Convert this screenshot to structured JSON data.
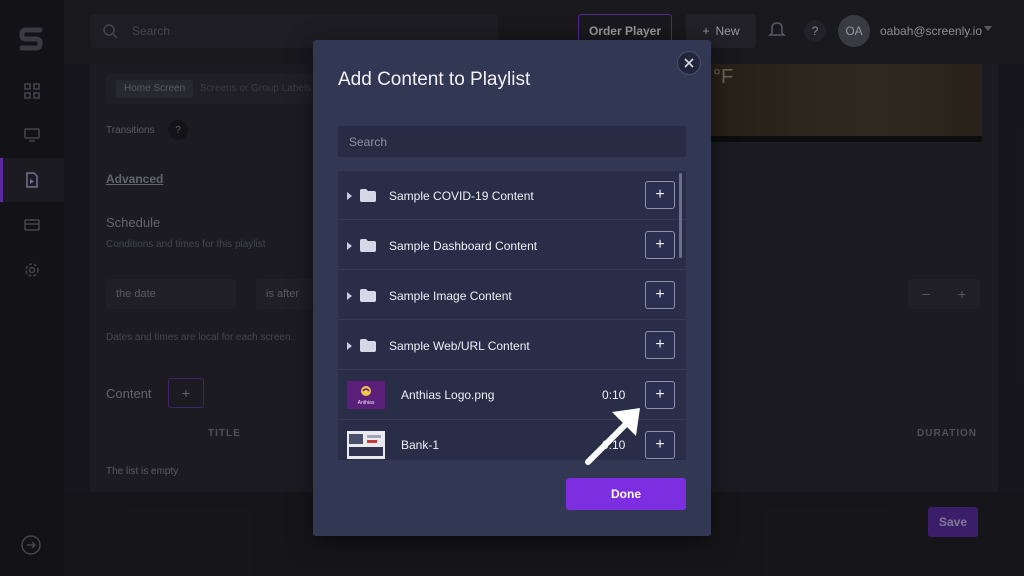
{
  "topbar": {
    "search_placeholder": "Search",
    "order_player_label": "Order Player",
    "new_label": "New",
    "help_label": "?",
    "avatar_initials": "OA",
    "user_email": "oabah@screenly.io"
  },
  "background": {
    "chip_home_screen": "Home Screen",
    "screens_placeholder": "Screens or Group Labels",
    "transitions_label": "Transitions",
    "help_label": "?",
    "advanced_link": "Advanced",
    "schedule_heading": "Schedule",
    "schedule_desc": "Conditions and times for this playlist",
    "condition_field": "the date",
    "condition_op": "is after",
    "local_note": "Dates and times are local for each screen.",
    "content_heading": "Content",
    "col_title": "TITLE",
    "col_duration": "DURATION",
    "empty_text": "The list is empty",
    "save_label": "Save",
    "weather_temp_unit": "°F",
    "stepper_minus": "−",
    "stepper_plus": "+"
  },
  "modal": {
    "title": "Add Content to Playlist",
    "search_placeholder": "Search",
    "folders": [
      {
        "name": "Sample COVID-19 Content"
      },
      {
        "name": "Sample Dashboard Content"
      },
      {
        "name": "Sample Image Content"
      },
      {
        "name": "Sample Web/URL Content"
      }
    ],
    "files": [
      {
        "name": "Anthias Logo.png",
        "duration": "0:10",
        "thumb_text": "Anthias"
      },
      {
        "name": "Bank-1",
        "duration": "0:10"
      }
    ],
    "add_symbol": "+",
    "done_label": "Done"
  },
  "colors": {
    "accent": "#7d2ee0",
    "modal_bg": "#323754",
    "list_bg": "#292d47"
  }
}
